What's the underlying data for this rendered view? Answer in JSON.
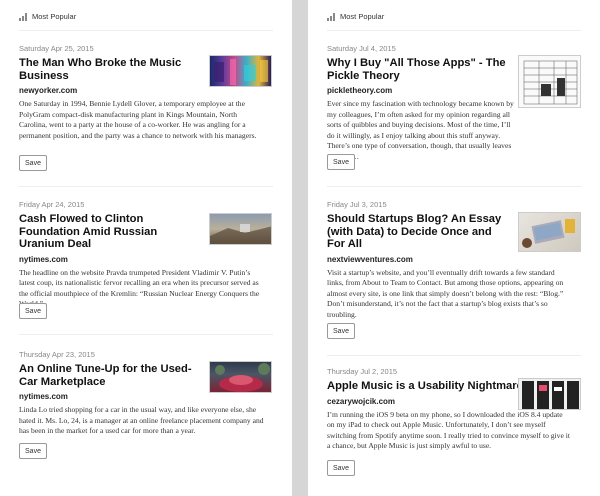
{
  "header": {
    "label": "Most Popular"
  },
  "save_label": "Save",
  "left": [
    {
      "date": "Saturday Apr 25, 2015",
      "title": "The Man Who Broke the Music Business",
      "source": "newyorker.com",
      "excerpt": "One Saturday in 1994, Bennie Lydell Glover, a temporary employee at the PolyGram compact-disk manufacturing plant in Kings Mountain, North Carolina, went to a party at the house of a co-worker. He was angling for a permanent position, and the party was a chance to network with his managers."
    },
    {
      "date": "Friday Apr 24, 2015",
      "title": "Cash Flowed to Clinton Foundation Amid Russian Uranium Deal",
      "source": "nytimes.com",
      "excerpt": "The headline on the website Pravda trumpeted President Vladimir V. Putin’s latest coup, its nationalistic fervor recalling an era when its precursor served as the official mouthpiece of the Kremlin: “Russian Nuclear Energy Conquers the World.”"
    },
    {
      "date": "Thursday Apr 23, 2015",
      "title": "An Online Tune-Up for the Used-Car Marketplace",
      "source": "nytimes.com",
      "excerpt": "Linda Lo tried shopping for a car in the usual way, and like everyone else, she hated it. Ms. Lo, 24, is a manager at an online freelance placement company and has been in the market for a used car for more than a year."
    }
  ],
  "right": [
    {
      "date": "Saturday Jul 4, 2015",
      "title": "Why I Buy \"All Those Apps\" - The Pickle Theory",
      "source": "pickletheory.com",
      "excerpt": "Ever since my fascination with technology became known by my colleagues, I’m often asked for my opinion regarding all sorts of quibbles and buying decisions. Most of the time, I’ll do it willingly, as I enjoy talking about this stuff anyway. There’s one type of conversation, though, that usually leaves me a bit…"
    },
    {
      "date": "Friday Jul 3, 2015",
      "title": "Should Startups Blog? An Essay (with Data) to Decide Once and For All",
      "source": "nextviewventures.com",
      "excerpt": "Visit a startup’s website, and you’ll eventually drift towards a few standard links, from About to Team to Contact. But among those options, appearing on almost every site, is one link that simply doesn’t belong with the rest: “Blog.” Don’t misunderstand, it’s not the fact that a startup’s blog exists that’s so troubling."
    },
    {
      "date": "Thursday Jul 2, 2015",
      "title": "Apple Music is a Usability Nightmare",
      "source": "cezarywojcik.com",
      "excerpt": "I’m running the iOS 9 beta on my phone, so I downloaded the iOS 8.4 update on my iPad to check out Apple Music. Unfortunately, I don’t see myself switching from Spotify anytime soon. I really tried to convince myself to give it a chance, but Apple Music is just simply awful to use."
    }
  ]
}
